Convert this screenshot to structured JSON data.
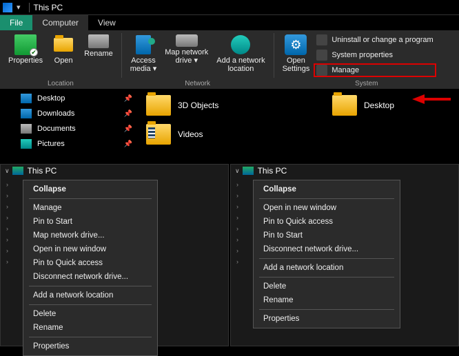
{
  "titlebar": {
    "title": "This PC"
  },
  "tabs": {
    "file": "File",
    "computer": "Computer",
    "view": "View"
  },
  "ribbon": {
    "properties": "Properties",
    "open": "Open",
    "rename": "Rename",
    "access_media": "Access\nmedia ▾",
    "map_network_drive": "Map network\ndrive ▾",
    "add_network_location": "Add a network\nlocation",
    "open_settings": "Open\nSettings",
    "uninstall": "Uninstall or change a program",
    "system_properties": "System properties",
    "manage": "Manage",
    "group_location": "Location",
    "group_network": "Network",
    "group_system": "System"
  },
  "nav": {
    "desktop": "Desktop",
    "downloads": "Downloads",
    "documents": "Documents",
    "pictures": "Pictures"
  },
  "content": {
    "objects3d": "3D Objects",
    "videos": "Videos",
    "desktop": "Desktop"
  },
  "panels": {
    "this_pc": "This PC"
  },
  "menu_left": {
    "collapse": "Collapse",
    "manage": "Manage",
    "pin_start": "Pin to Start",
    "map_drive": "Map network drive...",
    "open_new": "Open in new window",
    "pin_quick": "Pin to Quick access",
    "disconnect": "Disconnect network drive...",
    "add_location": "Add a network location",
    "delete": "Delete",
    "rename": "Rename",
    "properties": "Properties"
  },
  "menu_right": {
    "collapse": "Collapse",
    "open_new": "Open in new window",
    "pin_quick": "Pin to Quick access",
    "pin_start": "Pin to Start",
    "disconnect": "Disconnect network drive...",
    "add_location": "Add a network location",
    "delete": "Delete",
    "rename": "Rename",
    "properties": "Properties"
  }
}
